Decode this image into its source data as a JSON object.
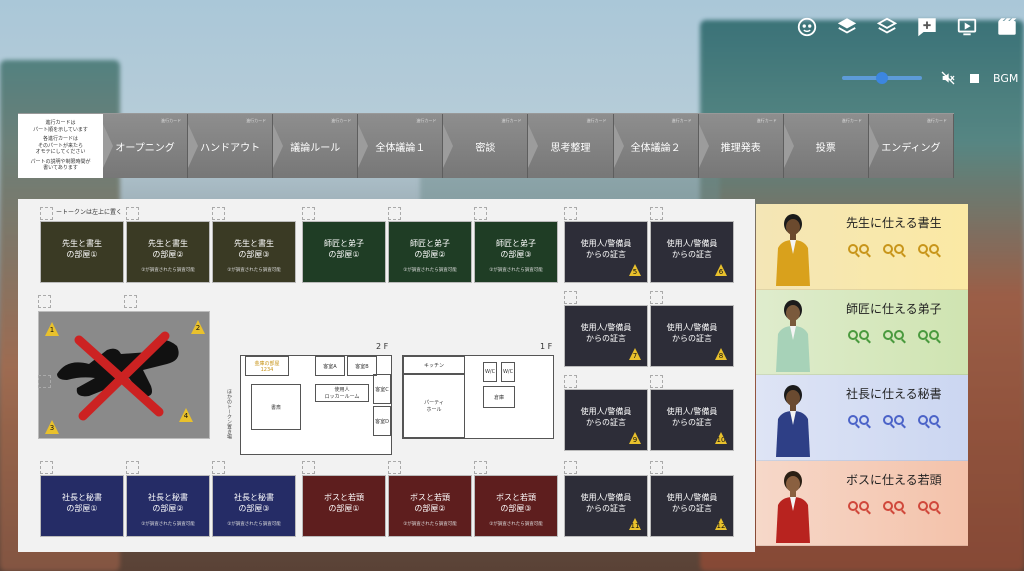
{
  "toolbar": {
    "icons": [
      "face-icon",
      "layers-icon",
      "layers-outline-icon",
      "add-note-icon",
      "screen-icon",
      "cinema-icon"
    ]
  },
  "audio": {
    "volume_percent": 50,
    "bgm_label": "BGM"
  },
  "phases": {
    "info_text": [
      "進行カードは",
      "パート順を示しています",
      "各進行カードは",
      "そのパートが来たら",
      "オモテにしてください",
      "パートの説明や制限時間が",
      "書いてあります"
    ],
    "tag": "進行カード",
    "cards": [
      "オープニング",
      "ハンドアウト",
      "議論ルール",
      "全体議論１",
      "密談",
      "思考整理",
      "全体議論２",
      "推理発表",
      "投票",
      "エンディング"
    ]
  },
  "board": {
    "token_hint": "ートークンは左上に置く",
    "side_hint": "ほかのトークン置き場",
    "sub_note": "②が調査されたら調査可能",
    "rooms_scholar": [
      "先生と書生\nの部屋①",
      "先生と書生\nの部屋②",
      "先生と書生\nの部屋③"
    ],
    "rooms_apprentice": [
      "師匠と弟子\nの部屋①",
      "師匠と弟子\nの部屋②",
      "師匠と弟子\nの部屋③"
    ],
    "rooms_secretary": [
      "社長と秘書\nの部屋①",
      "社長と秘書\nの部屋②",
      "社長と秘書\nの部屋③"
    ],
    "rooms_boss": [
      "ボスと若頭\nの部屋①",
      "ボスと若頭\nの部屋②",
      "ボスと若頭\nの部屋③"
    ],
    "testimony_label": "使用人/警備員\nからの証言",
    "testimony_numbers": [
      "5",
      "6",
      "7",
      "8",
      "9",
      "10",
      "11",
      "12"
    ],
    "scene_numbers": [
      "1",
      "2",
      "3",
      "4"
    ],
    "floor2": {
      "label": "2 F",
      "rooms": [
        "金庫の部屋\n1234",
        "客室A",
        "客室B",
        "書斎",
        "使用人\nロッカールーム",
        "客室C",
        "客室D"
      ]
    },
    "floor1": {
      "label": "1 F",
      "rooms": [
        "キッチン",
        "W/C",
        "W/C",
        "パーティ\nホール",
        "倉庫"
      ]
    }
  },
  "characters": [
    {
      "name": "先生に仕える書生",
      "color": "#d9a11c",
      "lens_color": "#c8951a"
    },
    {
      "name": "師匠に仕える弟子",
      "color": "#6aa15c",
      "lens_color": "#4a9a3e"
    },
    {
      "name": "社長に仕える秘書",
      "color": "#3a5fb8",
      "lens_color": "#4b63c8"
    },
    {
      "name": "ボスに仕える若頭",
      "color": "#c23a2a",
      "lens_color": "#d0483b"
    }
  ]
}
